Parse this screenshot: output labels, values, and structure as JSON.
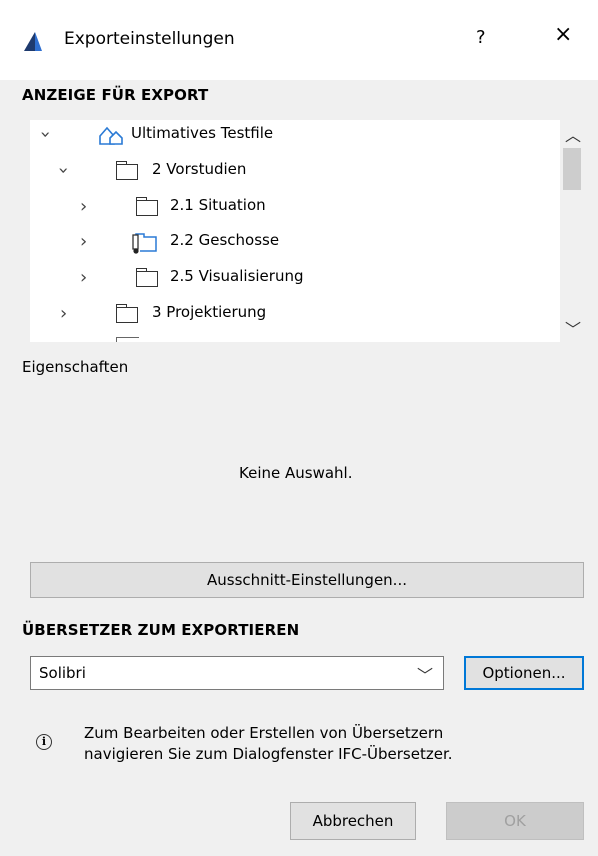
{
  "window": {
    "title": "Exporteinstellungen",
    "help_label": "?",
    "close_label": "×",
    "icon": "archicad-logo-icon"
  },
  "export_view": {
    "heading": "ANZEIGE FÜR EXPORT",
    "tree": [
      {
        "label": "Ultimatives Testfile",
        "expanded": true,
        "icon": "project-icon"
      },
      {
        "label": "2 Vorstudien",
        "expanded": true,
        "icon": "folder-icon"
      },
      {
        "label": "2.1 Situation",
        "expanded": false,
        "icon": "folder-icon"
      },
      {
        "label": "2.2 Geschosse",
        "expanded": false,
        "icon": "viewpoint-folder-icon"
      },
      {
        "label": "2.5 Visualisierung",
        "expanded": false,
        "icon": "folder-icon"
      },
      {
        "label": "3 Projektierung",
        "expanded": false,
        "icon": "folder-icon"
      }
    ]
  },
  "properties": {
    "label": "Eigenschaften",
    "empty_message": "Keine Auswahl."
  },
  "clip_settings_button": "Ausschnitt-Einstellungen...",
  "translator": {
    "heading": "ÜBERSETZER ZUM EXPORTIEREN",
    "selected": "Solibri",
    "options_button": "Optionen..."
  },
  "info": {
    "line1": "Zum Bearbeiten oder Erstellen von Übersetzern",
    "line2": "navigieren Sie zum Dialogfenster IFC-Übersetzer."
  },
  "footer": {
    "cancel": "Abbrechen",
    "ok": "OK"
  }
}
